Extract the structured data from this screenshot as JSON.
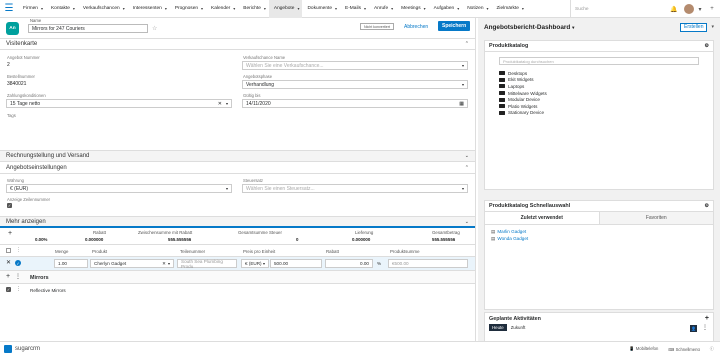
{
  "nav": {
    "modules": [
      "Firmen",
      "Kontakte",
      "Verkaufschancen",
      "Interessenten",
      "Prognosen",
      "Kalender",
      "Berichte",
      "Angebote",
      "Dokumente",
      "E-Mails",
      "Anrufe",
      "Meetings",
      "Aufgaben",
      "Notizen",
      "Zielmärkte"
    ],
    "active_module": "Angebote",
    "search_placeholder": "Suche"
  },
  "record": {
    "avatar_text": "An",
    "name_label": "Name",
    "name_value": "Mirrors for 247 Couriers",
    "badge": "Nicht konvertiert",
    "cancel": "Abbrechen",
    "save": "Speichern"
  },
  "visitenkarte": {
    "title": "Visitenkarte",
    "fields": {
      "angebot_nummer_label": "Angebot Nummer",
      "angebot_nummer_value": "2",
      "verkaufschance_label": "Verkaufschance Name",
      "verkaufschance_placeholder": "Wählen Sie eine Verkaufschance...",
      "bestellnummer_label": "Bestellnummer",
      "bestellnummer_value": "3840021",
      "angebotsphase_label": "Angebotsphase",
      "angebotsphase_value": "Verhandlung",
      "zahlung_label": "Zahlungskonditionen",
      "zahlung_value": "15 Tage netto",
      "gueltig_label": "Gültig bis",
      "gueltig_value": "14/11/2020",
      "tags_label": "Tags"
    }
  },
  "panels": {
    "rechnung": "Rechnungstellung und Versand",
    "angebotseinstellungen": "Angebotseinstellungen",
    "mehr": "Mehr anzeigen"
  },
  "settings": {
    "waehrung_label": "Währung",
    "waehrung_value": "€ (EUR)",
    "steuersatz_label": "Steuersatz",
    "steuersatz_placeholder": "Wählen Sie einen Steuersatz...",
    "zeilennummer_label": "Anzeige Zeilennummer"
  },
  "summary": {
    "rabatt_pct": "0.00%",
    "rabatt_label": "Rabatt",
    "rabatt_value": "0.000000",
    "zwischen_label": "Zwischensumme mit Rabatt",
    "zwischen_value": "555.555556",
    "steuer_label": "Gesamtsumme Steuer",
    "steuer_value": "0",
    "lieferung_label": "Lieferung",
    "lieferung_value": "0.000000",
    "gesamt_label": "Gesamtbetrag",
    "gesamt_value": "555.555556"
  },
  "table": {
    "headers": [
      "Menge",
      "Produkt",
      "Teilenummer",
      "Preis pro Einheit",
      "Rabatt",
      "Produktsumme"
    ],
    "row": {
      "menge": "1.00",
      "produkt": "Cherlyn Gadget",
      "teilenummer": "South Sea Plumbing Produ",
      "currency": "€ (EUR)",
      "preis": "500.00",
      "rabatt": "0.00",
      "rabatt_unit": "%",
      "summe": "€500.00"
    },
    "group": "Mirrors",
    "group_item": "Reflective Mirrors"
  },
  "dashboard": {
    "title": "Angebotsbericht-Dashboard",
    "create": "Erstellen",
    "catalog_title": "Produktkatalog",
    "catalog_search": "Produktkatalog durchsuchen",
    "folders": [
      "Desktops",
      "Ekit Widgets",
      "Laptops",
      "Mittelware Widgets",
      "Modular Device",
      "Platio Widgets",
      "Stationary Device"
    ],
    "quick_title": "Produktkatalog Schnellauswahl",
    "tab_recent": "Zuletzt verwendet",
    "tab_fav": "Favoriten",
    "recent_items": [
      "Marlin Gadget",
      "Wonda Gadget"
    ],
    "activities_title": "Geplante Aktivitäten",
    "act_today": "Heute",
    "act_future": "Zukunft"
  },
  "footer": {
    "brand": "sugarcrm",
    "mobile": "Mobiltelefon",
    "shortcuts": "Schnellmenü"
  }
}
